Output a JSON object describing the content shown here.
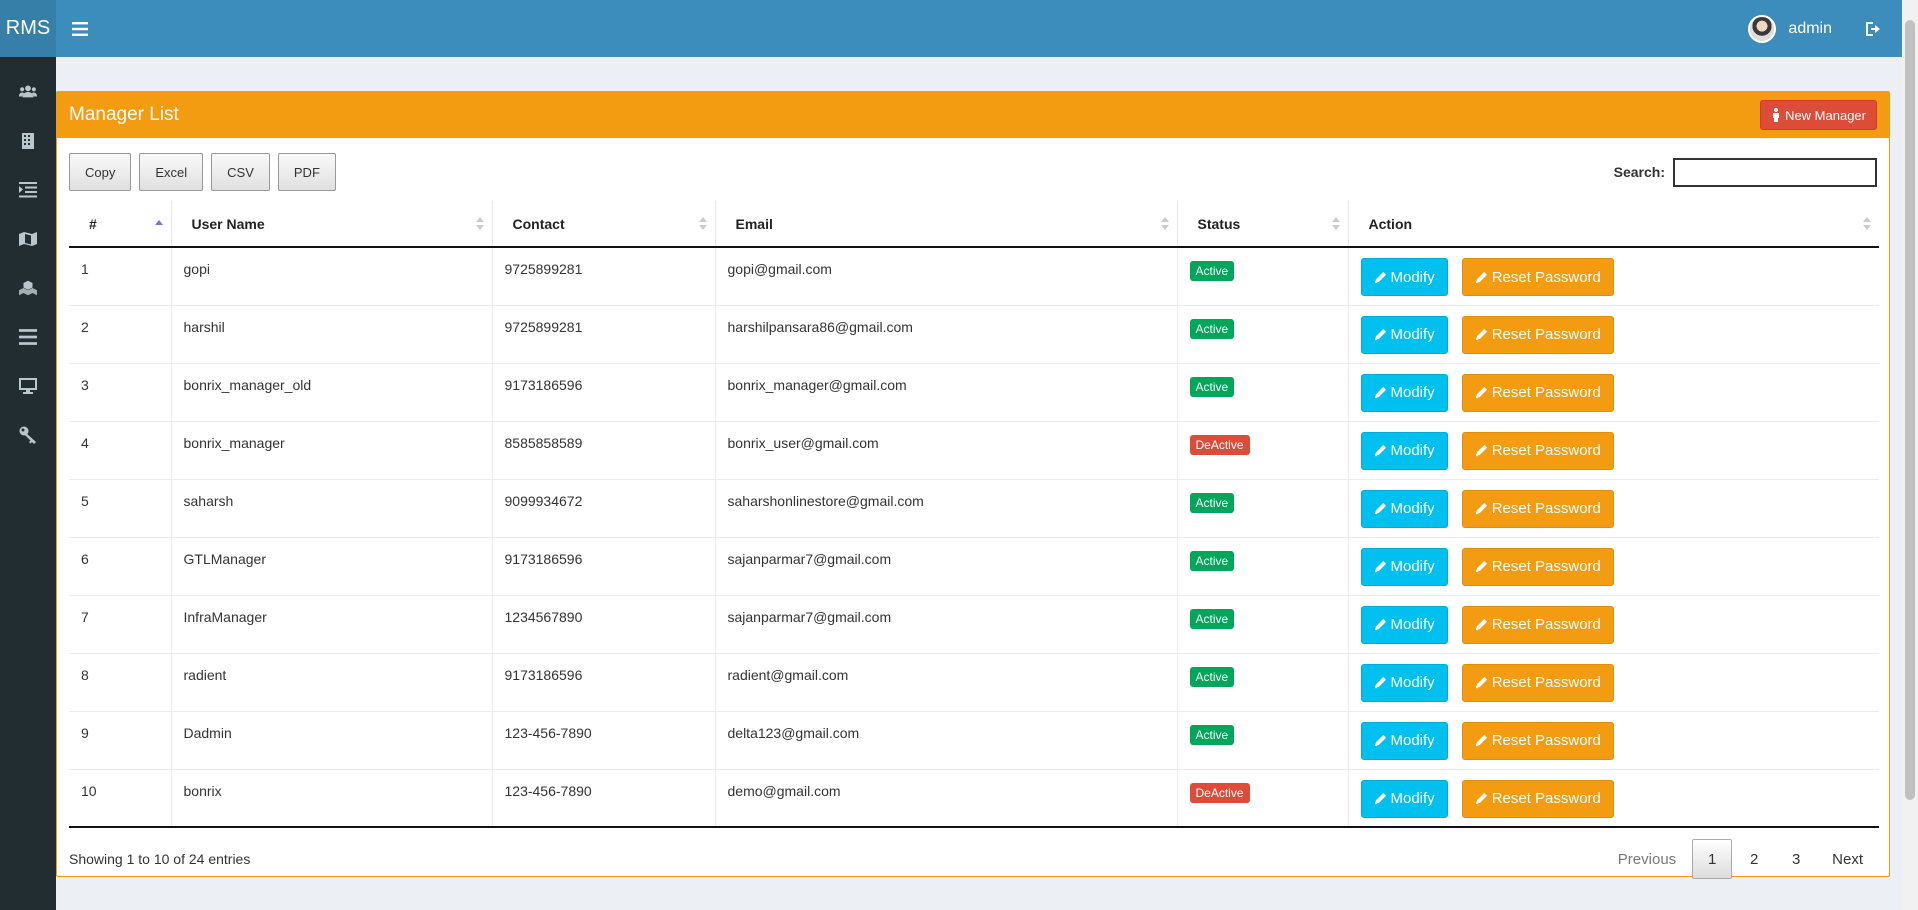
{
  "brand": "RMS",
  "user": {
    "name": "admin"
  },
  "sidebar": {
    "items": [
      {
        "icon": "users-icon"
      },
      {
        "icon": "building-icon"
      },
      {
        "icon": "list-indent-icon"
      },
      {
        "icon": "map-icon"
      },
      {
        "icon": "cubes-icon"
      },
      {
        "icon": "bars-icon"
      },
      {
        "icon": "desktop-icon"
      },
      {
        "icon": "key-icon"
      }
    ]
  },
  "box": {
    "title": "Manager List",
    "new_button": "New Manager"
  },
  "toolbar": {
    "buttons": [
      "Copy",
      "Excel",
      "CSV",
      "PDF"
    ],
    "search_label": "Search:",
    "search_value": ""
  },
  "table": {
    "headers": [
      "#",
      "User Name",
      "Contact",
      "Email",
      "Status",
      "Action"
    ],
    "rows": [
      {
        "id": "1",
        "user": "gopi",
        "contact": "9725899281",
        "email": "gopi@gmail.com",
        "status": "Active"
      },
      {
        "id": "2",
        "user": "harshil",
        "contact": "9725899281",
        "email": "harshilpansara86@gmail.com",
        "status": "Active"
      },
      {
        "id": "3",
        "user": "bonrix_manager_old",
        "contact": "9173186596",
        "email": "bonrix_manager@gmail.com",
        "status": "Active"
      },
      {
        "id": "4",
        "user": "bonrix_manager",
        "contact": "8585858589",
        "email": "bonrix_user@gmail.com",
        "status": "DeActive"
      },
      {
        "id": "5",
        "user": "saharsh",
        "contact": "9099934672",
        "email": "saharshonlinestore@gmail.com",
        "status": "Active"
      },
      {
        "id": "6",
        "user": "GTLManager",
        "contact": "9173186596",
        "email": "sajanparmar7@gmail.com",
        "status": "Active"
      },
      {
        "id": "7",
        "user": "InfraManager",
        "contact": "1234567890",
        "email": "sajanparmar7@gmail.com",
        "status": "Active"
      },
      {
        "id": "8",
        "user": "radient",
        "contact": "9173186596",
        "email": "radient@gmail.com",
        "status": "Active"
      },
      {
        "id": "9",
        "user": "Dadmin",
        "contact": "123-456-7890",
        "email": "delta123@gmail.com",
        "status": "Active"
      },
      {
        "id": "10",
        "user": "bonrix",
        "contact": "123-456-7890",
        "email": "demo@gmail.com",
        "status": "DeActive"
      }
    ],
    "modify_label": "Modify",
    "reset_label": "Reset Password"
  },
  "footer": {
    "info": "Showing 1 to 10 of 24 entries",
    "prev": "Previous",
    "pages": [
      "1",
      "2",
      "3"
    ],
    "current_page": "1",
    "next": "Next"
  },
  "colors": {
    "topbar": "#3c8dbc",
    "sidebar": "#222d32",
    "box_header": "#f39c12",
    "active": "#00a65a",
    "deactive": "#dd4b39",
    "modify": "#00c0ef"
  }
}
